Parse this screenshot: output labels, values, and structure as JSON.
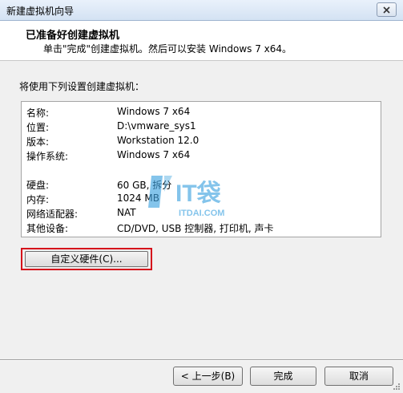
{
  "window": {
    "title": "新建虚拟机向导"
  },
  "header": {
    "title": "已准备好创建虚拟机",
    "subtitle": "单击\"完成\"创建虚拟机。然后可以安装 Windows 7 x64。"
  },
  "intro": "将使用下列设置创建虚拟机：",
  "settings": [
    {
      "label": "名称:",
      "value": "Windows 7 x64"
    },
    {
      "label": "位置:",
      "value": "D:\\vmware_sys1"
    },
    {
      "label": "版本:",
      "value": "Workstation 12.0"
    },
    {
      "label": "操作系统:",
      "value": "Windows 7 x64"
    },
    {
      "label": "硬盘:",
      "value": "60 GB, 拆分"
    },
    {
      "label": "内存:",
      "value": "1024 MB"
    },
    {
      "label": "网络适配器:",
      "value": "NAT"
    },
    {
      "label": "其他设备:",
      "value": "CD/DVD, USB 控制器, 打印机, 声卡"
    }
  ],
  "watermark": {
    "brand": "IT袋",
    "site": "ITDAI.COM"
  },
  "buttons": {
    "customize": "自定义硬件(C)...",
    "back": "< 上一步(B)",
    "finish": "完成",
    "cancel": "取消"
  },
  "colors": {
    "highlight": "#d5101b",
    "watermark": "#3fa3e0"
  },
  "icons": {
    "close": "close-icon",
    "grip": "resize-grip-icon"
  }
}
